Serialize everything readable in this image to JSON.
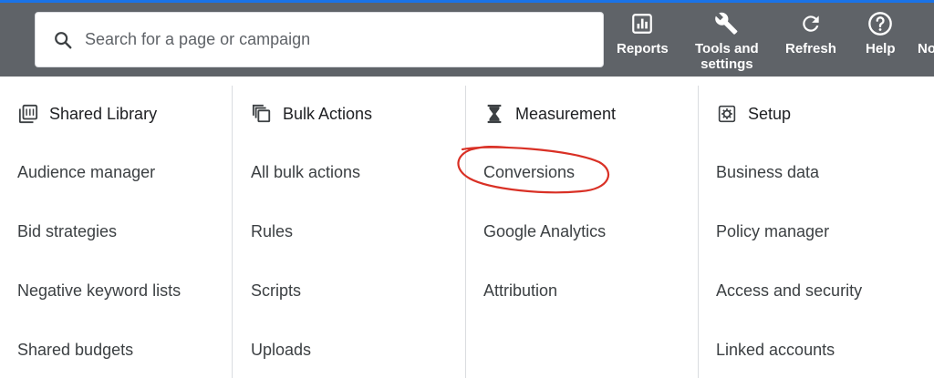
{
  "search": {
    "placeholder": "Search for a page or campaign",
    "value": ""
  },
  "toolbar": [
    {
      "label": "Reports",
      "icon": "reports-icon"
    },
    {
      "label": "Tools and\nsettings",
      "icon": "wrench-icon"
    },
    {
      "label": "Refresh",
      "icon": "refresh-icon"
    },
    {
      "label": "Help",
      "icon": "help-icon"
    },
    {
      "label": "No",
      "icon": "bell-icon"
    }
  ],
  "columns": [
    {
      "title": "Shared Library",
      "icon": "library-icon",
      "items": [
        "Audience manager",
        "Bid strategies",
        "Negative keyword lists",
        "Shared budgets"
      ]
    },
    {
      "title": "Bulk Actions",
      "icon": "bulk-actions-icon",
      "items": [
        "All bulk actions",
        "Rules",
        "Scripts",
        "Uploads"
      ]
    },
    {
      "title": "Measurement",
      "icon": "hourglass-icon",
      "items": [
        "Conversions",
        "Google Analytics",
        "Attribution"
      ]
    },
    {
      "title": "Setup",
      "icon": "setup-icon",
      "items": [
        "Business data",
        "Policy manager",
        "Access and security",
        "Linked accounts"
      ]
    }
  ],
  "colors": {
    "topbar": "#5f6368",
    "accent": "#1a73e8",
    "annotation": "#d93025"
  }
}
